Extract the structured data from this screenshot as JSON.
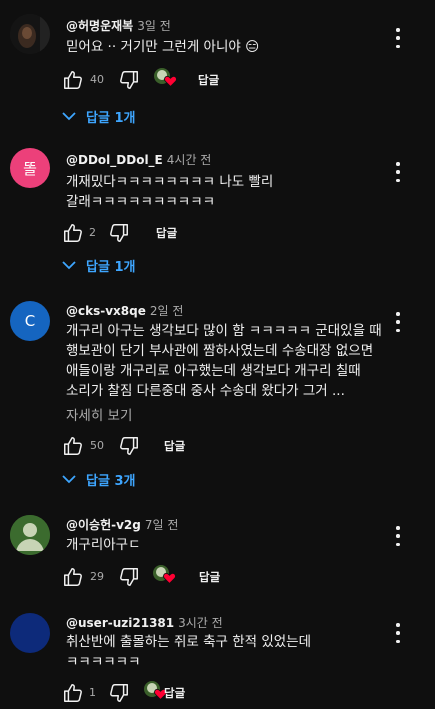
{
  "comments": [
    {
      "author": "@허명운재복",
      "time": "3일 전",
      "text": "믿어요 ·· 거기만 그런게 아니야 😑",
      "likes": "40",
      "reply_label": "답글",
      "replies_label": "답글 1개",
      "avatar_color": "#1a1a1a",
      "creator_heart": true
    },
    {
      "author": "@DDol_DDol_E",
      "time": "4시간 전",
      "text": "개재밌다ㅋㅋㅋㅋㅋㅋㅋㅋ 나도 빨리 갈래ㅋㅋㅋㅋㅋㅋㅋㅋㅋㅋ",
      "likes": "2",
      "reply_label": "답글",
      "replies_label": "답글 1개",
      "avatar_letter": "똘",
      "avatar_color": "#ec407a",
      "creator_heart": false
    },
    {
      "author": "@cks-vx8qe",
      "time": "2일 전",
      "text": "개구리 아구는 생각보다 많이 함 ㅋㅋㅋㅋㅋ 군대있을 때 행보관이 단기 부사관에 짬하사였는데 수송대장 없으면 애들이랑 개구리로 아구했는데 생각보다 개구리 칠때 소리가 찰짐 다른중대 중사 수송대 왔다가 그거 ...",
      "more_label": "자세히 보기",
      "likes": "50",
      "reply_label": "답글",
      "replies_label": "답글 3개",
      "avatar_letter": "C",
      "avatar_color": "#1565c0",
      "creator_heart": false
    },
    {
      "author": "@이승헌-v2g",
      "time": "7일 전",
      "text": "개구리아구ㄷ",
      "likes": "29",
      "reply_label": "답글",
      "avatar_color": "#3b6b2e",
      "creator_heart": true
    },
    {
      "author": "@user-uzi21381",
      "time": "3시간 전",
      "text": "취산반에 출몰하는 쥐로 축구 한적 있었는데 ㅋㅋㅋㅋㅋㅋ",
      "likes": "1",
      "reply_label": "답글",
      "avatar_color": "#0d2a7a",
      "creator_heart": true
    }
  ]
}
